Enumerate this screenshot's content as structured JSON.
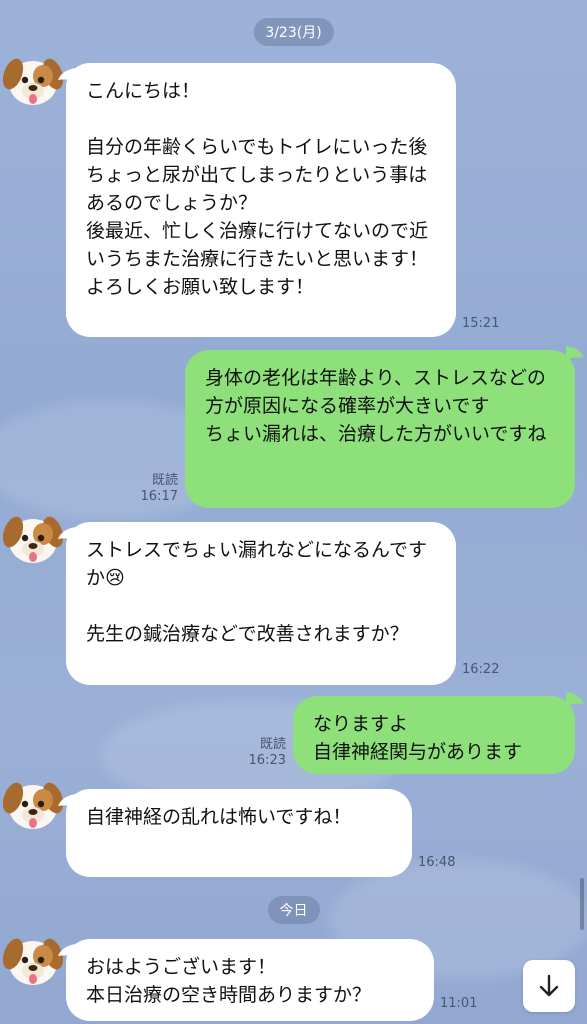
{
  "chat": {
    "date_1": "3/23(月)",
    "date_2": "今日",
    "msg1": {
      "text": "こんにちは！\n\n自分の年齢くらいでもトイレにいった後ちょっと尿が出てしまったりという事はあるのでしょうか？\n後最近、忙しく治療に行けてないので近いうちまた治療に行きたいと思います！\nよろしくお願い致します！",
      "time": "15:21"
    },
    "msg2": {
      "text": "身体の老化は年齢より、ストレスなどの方が原因になる確率が大きいです\nちょい漏れは、治療した方がいいですね",
      "read": "既読",
      "time": "16:17"
    },
    "msg3": {
      "text": "ストレスでちょい漏れなどになるんですか😢\n\n先生の鍼治療などで改善されますか？",
      "time": "16:22"
    },
    "msg4": {
      "text": "なりますよ\n自律神経関与があります",
      "read": "既読",
      "time": "16:23"
    },
    "msg5": {
      "text": "自律神経の乱れは怖いですね！",
      "time": "16:48"
    },
    "msg6": {
      "text": "おはようございます！\n本日治療の空き時間ありますか？",
      "time": "11:01"
    }
  },
  "icons": {
    "avatar": "dog-face-icon",
    "scroll": "arrow-down-icon"
  }
}
